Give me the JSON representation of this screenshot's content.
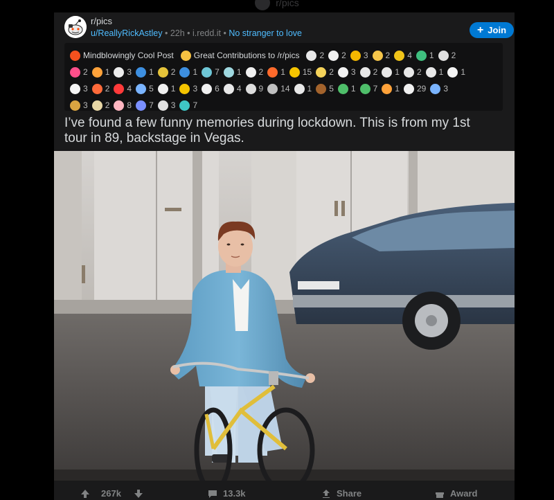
{
  "ghost_header": {
    "label": "r/pics"
  },
  "post": {
    "subreddit": "r/pics",
    "author": "u/ReallyRickAstley",
    "sep1": " • ",
    "time": "22h",
    "sep2": " • ",
    "domain": "i.redd.it",
    "sep3": " • ",
    "flair": "No stranger to love",
    "join_label": "Join",
    "title": "I’ve found a few funny memories during lockdown. This is from my 1st tour in 89, backstage in Vegas."
  },
  "awards": {
    "rows": [
      [
        {
          "icon": "explosion-award-icon",
          "color": "#f4511e",
          "name": "Mindblowingly Cool Post"
        },
        {
          "icon": "crown-award-icon",
          "color": "#f6c142",
          "name": "Great Contributions to /r/pics"
        },
        {
          "icon": "snoo-award-icon",
          "color": "#e8e8e8",
          "count": "2"
        },
        {
          "icon": "snoo-face-award-icon",
          "color": "#f0f0f0",
          "count": "2"
        },
        {
          "icon": "sun-award-icon",
          "color": "#f5b800",
          "count": "3"
        },
        {
          "icon": "laugh-award-icon",
          "color": "#f5c54a",
          "count": "2"
        },
        {
          "icon": "helmet-award-icon",
          "color": "#f0c419",
          "count": "4"
        },
        {
          "icon": "frog-award-icon",
          "color": "#3fbf7f",
          "count": "1"
        },
        {
          "icon": "shock-award-icon",
          "color": "#e0e0e0",
          "count": "2"
        }
      ],
      [
        {
          "icon": "heart-award-icon",
          "color": "#ff4f8b",
          "count": "2"
        },
        {
          "icon": "party-award-icon",
          "color": "#ffa23a",
          "count": "1"
        },
        {
          "icon": "chef-award-icon",
          "color": "#ececec",
          "count": "3"
        },
        {
          "icon": "i-award-icon",
          "color": "#3d8fe0",
          "count": "1"
        },
        {
          "icon": "oc-award-icon",
          "color": "#e5c33a",
          "count": "2"
        },
        {
          "icon": "p-award-icon",
          "color": "#3d8fe0",
          "count": "1"
        },
        {
          "icon": "face-award-icon",
          "color": "#6ec6d6",
          "count": "7"
        },
        {
          "icon": "photo-award-icon",
          "color": "#9fd8e0",
          "count": "1"
        },
        {
          "icon": "wholesome-award-icon",
          "color": "#f0f0f0",
          "count": "2"
        },
        {
          "icon": "fire-award-icon",
          "color": "#ff6a2b",
          "count": "1"
        },
        {
          "icon": "gold-award-icon",
          "color": "#f5c400",
          "count": "15"
        },
        {
          "icon": "clap-award-icon",
          "color": "#f4d25a",
          "count": "2"
        },
        {
          "icon": "bee-award-icon",
          "color": "#f2f2f2",
          "count": "3"
        },
        {
          "icon": "hug-award-icon",
          "color": "#e8e8e8",
          "count": "2"
        },
        {
          "icon": "dance-award-icon",
          "color": "#e8e8e8",
          "count": "1"
        },
        {
          "icon": "wave-award-icon",
          "color": "#e8e8e8",
          "count": "2"
        },
        {
          "icon": "thumbs-award-icon",
          "color": "#e8e8e8",
          "count": "1"
        },
        {
          "icon": "bunny-award-icon",
          "color": "#f4f4f4",
          "count": "1"
        }
      ],
      [
        {
          "icon": "unicorn-award-icon",
          "color": "#f4f4f4",
          "count": "3"
        },
        {
          "icon": "year-2020-award-icon",
          "color": "#ff6a3a",
          "count": "2"
        },
        {
          "icon": "devil-award-icon",
          "color": "#ff3a3a",
          "count": "4"
        },
        {
          "icon": "rocket-award-icon",
          "color": "#7ab4ff",
          "count": "5"
        },
        {
          "icon": "skull-award-icon",
          "color": "#f0f0f0",
          "count": "1"
        },
        {
          "icon": "trophy-award-icon",
          "color": "#f5c400",
          "count": "3"
        },
        {
          "icon": "f-award-icon",
          "color": "#f0f0f0",
          "count": "6"
        },
        {
          "icon": "hands-award-icon",
          "color": "#e8e8e8",
          "count": "4"
        },
        {
          "icon": "eye-award-icon",
          "color": "#dddddd",
          "count": "9"
        },
        {
          "icon": "silver-award-icon",
          "color": "#c0c0c0",
          "count": "14"
        },
        {
          "icon": "cat-award-icon",
          "color": "#e8e8e8",
          "count": "1"
        },
        {
          "icon": "poop-award-icon",
          "color": "#a3632c",
          "count": "5"
        },
        {
          "icon": "alien-award-icon",
          "color": "#4fbf6a",
          "count": "1"
        },
        {
          "icon": "plant-award-icon",
          "color": "#4fbf6a",
          "count": "7"
        },
        {
          "icon": "campfire-award-icon",
          "color": "#ffa23a",
          "count": "1"
        },
        {
          "icon": "helper-award-icon",
          "color": "#f0f0f0",
          "count": "29"
        },
        {
          "icon": "screen-award-icon",
          "color": "#7ab4ff",
          "count": "3"
        }
      ],
      [
        {
          "icon": "box-award-icon",
          "color": "#d9a441",
          "count": "3"
        },
        {
          "icon": "doc-award-icon",
          "color": "#e8d7a5",
          "count": "2"
        },
        {
          "icon": "love-award-icon",
          "color": "#ffb6c1",
          "count": "8"
        },
        {
          "icon": "calendar-award-icon",
          "color": "#7a8fff",
          "count": "7"
        },
        {
          "icon": "frame-award-icon",
          "color": "#e0e0e0",
          "count": "3"
        },
        {
          "icon": "bird-award-icon",
          "color": "#3fc6c6",
          "count": "7"
        }
      ]
    ]
  },
  "actions": {
    "upvotes": "267k",
    "comments": "13.3k",
    "share": "Share",
    "award": "Award"
  }
}
